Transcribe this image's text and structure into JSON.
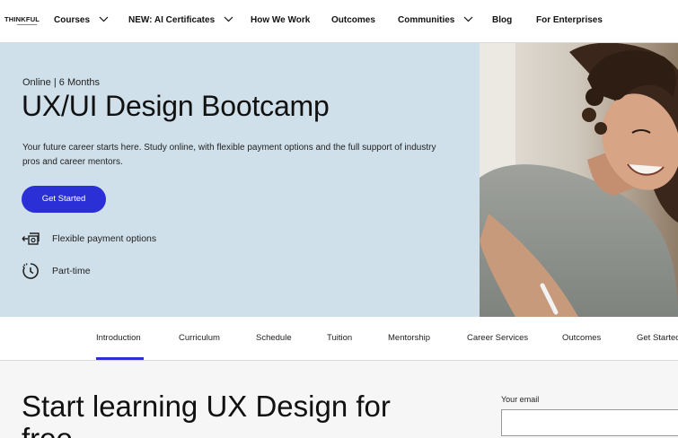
{
  "nav": {
    "logo": "THINKFUL",
    "items": [
      {
        "label": "Courses",
        "has_chevron": true
      },
      {
        "label": "NEW: AI Certificates",
        "has_chevron": true
      },
      {
        "label": "How We Work",
        "has_chevron": false
      },
      {
        "label": "Outcomes",
        "has_chevron": false
      },
      {
        "label": "Communities",
        "has_chevron": true
      },
      {
        "label": "Blog",
        "has_chevron": false
      },
      {
        "label": "For Enterprises",
        "has_chevron": false
      }
    ]
  },
  "hero": {
    "eyebrow": "Online | 6 Months",
    "title": "UX/UI Design Bootcamp",
    "description": "Your future career starts here. Study online, with flexible payment options and the full support of industry pros and career mentors.",
    "cta_label": "Get Started",
    "features": [
      {
        "icon": "payment-icon",
        "label": "Flexible payment options"
      },
      {
        "icon": "clock-icon",
        "label": "Part-time"
      }
    ],
    "background_color": "#cfe0ea"
  },
  "tabs": {
    "items": [
      "Introduction",
      "Curriculum",
      "Schedule",
      "Tuition",
      "Mentorship",
      "Career Services",
      "Outcomes",
      "Get Started"
    ],
    "active": "Introduction",
    "accent_color": "#2b30d6"
  },
  "lower": {
    "title": "Start learning UX Design for free",
    "email_label": "Your email",
    "email_value": ""
  }
}
